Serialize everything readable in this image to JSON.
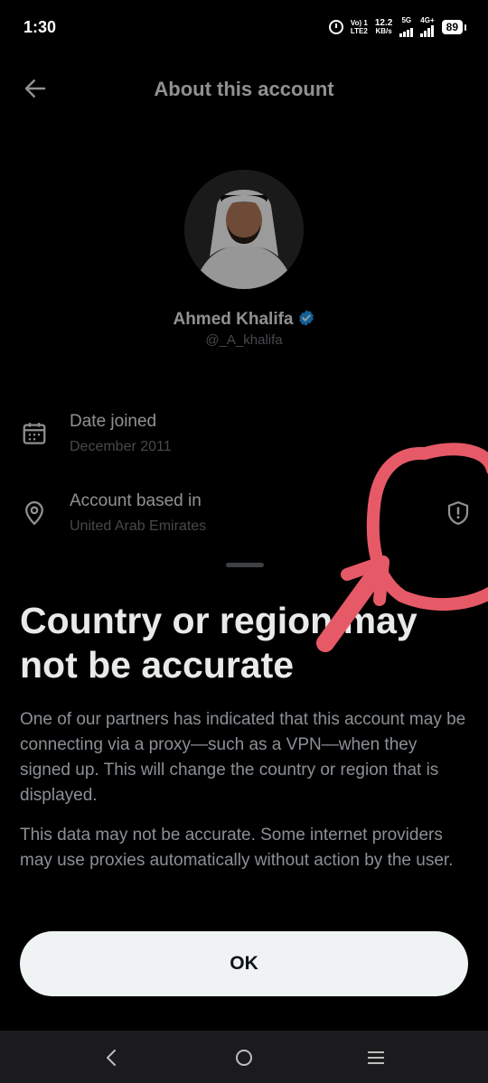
{
  "status_bar": {
    "time": "1:30",
    "volte_line1": "Vo) 1",
    "volte_line2": "LTE2",
    "speed_value": "12.2",
    "speed_unit": "KB/s",
    "network_5g": "5G",
    "network_4g": "4G+",
    "battery": "89"
  },
  "header": {
    "title": "About this account",
    "back_icon": "arrow-left-icon"
  },
  "profile": {
    "name": "Ahmed Khalifa",
    "handle": "@_A_khalifa",
    "verified": true
  },
  "info": {
    "date_joined_label": "Date joined",
    "date_joined_value": "December 2011",
    "based_in_label": "Account based in",
    "based_in_value": "United Arab Emirates",
    "based_in_icon": "shield-alert-icon"
  },
  "sheet": {
    "title": "Country or region may not be accurate",
    "paragraph1": "One of our partners has indicated that this account may be connecting via a proxy—such as a VPN—when they signed up. This will change the country or region that is displayed.",
    "paragraph2": "This data may not be accurate. Some internet providers may use proxies automatically without action by the user.",
    "ok_label": "OK"
  },
  "colors": {
    "verified_blue": "#1d9bf0",
    "annotation_red": "#e65a68",
    "button_bg": "#eff3f4"
  }
}
